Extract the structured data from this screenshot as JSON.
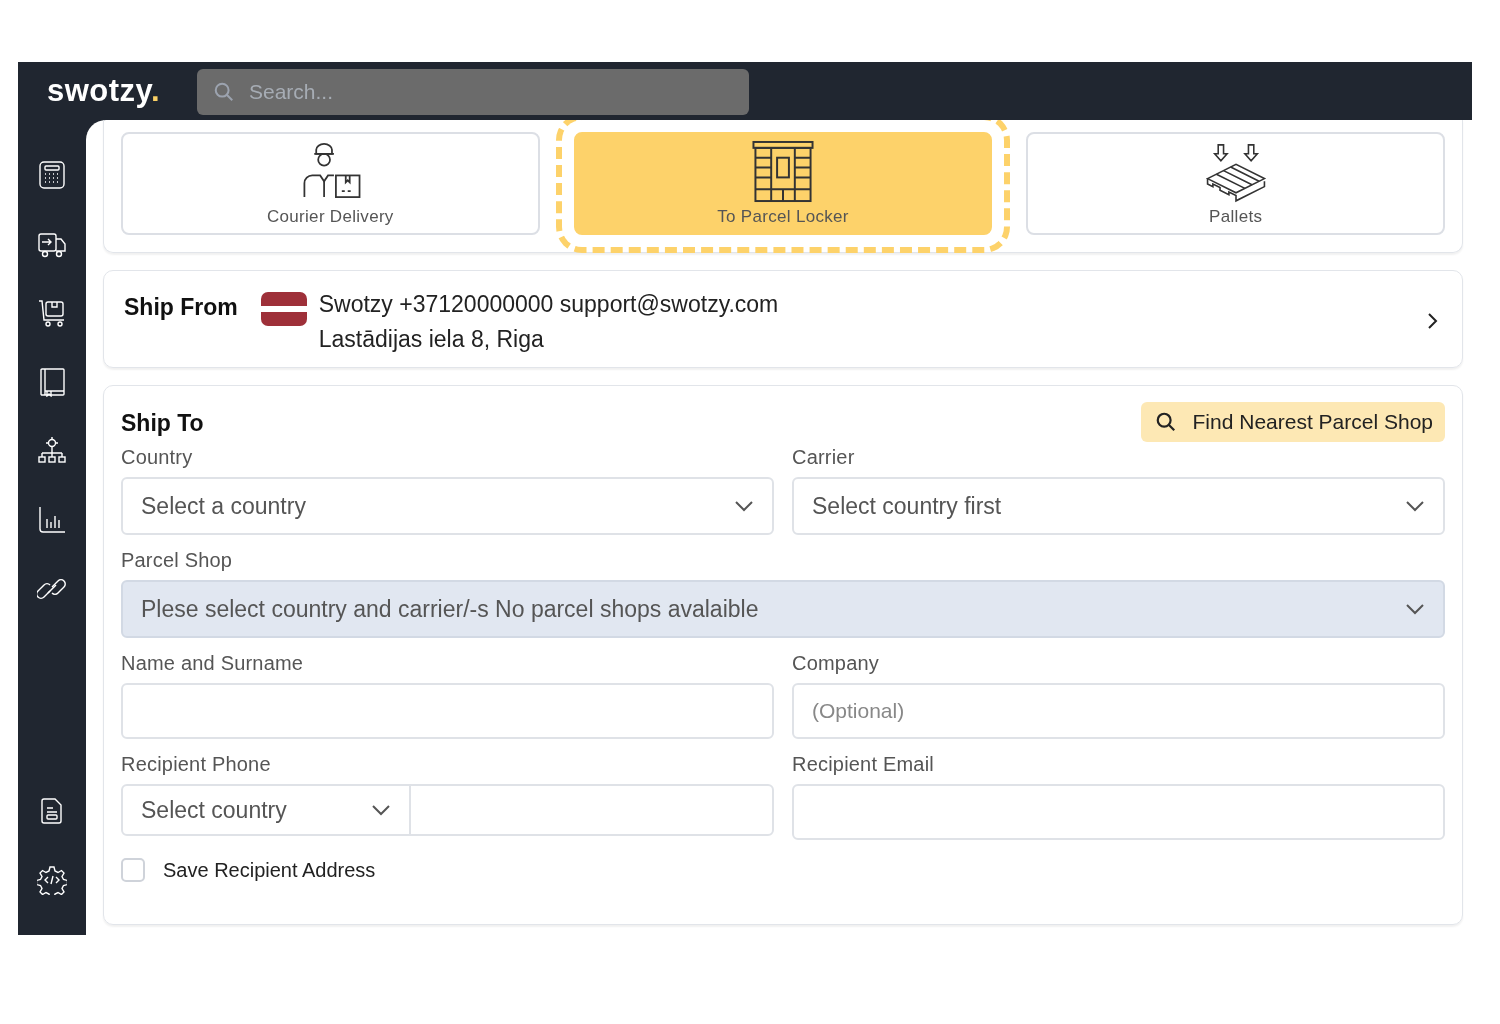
{
  "brand": {
    "name": "swotzy",
    "mark": "."
  },
  "search": {
    "placeholder": "Search..."
  },
  "sidebar": {
    "top": [
      {
        "kind": "calculator"
      },
      {
        "kind": "truck"
      },
      {
        "kind": "cart"
      },
      {
        "kind": "book"
      },
      {
        "kind": "hierarchy"
      },
      {
        "kind": "chart"
      },
      {
        "kind": "link"
      }
    ],
    "bottom": [
      {
        "kind": "document"
      },
      {
        "kind": "code-gear"
      }
    ]
  },
  "delivery_options": [
    {
      "label": "Courier Delivery",
      "kind": "courier",
      "selected": false
    },
    {
      "label": "To Parcel Locker",
      "kind": "locker",
      "selected": true
    },
    {
      "label": "Pallets",
      "kind": "pallet",
      "selected": false
    }
  ],
  "ship_from": {
    "title": "Ship From",
    "contact": "Swotzy +37120000000 support@swotzy.com",
    "address": "Lastādijas iela 8, Riga"
  },
  "ship_to": {
    "title": "Ship To",
    "find_button": "Find Nearest Parcel Shop",
    "country": {
      "label": "Country",
      "placeholder": "Select a country"
    },
    "carrier": {
      "label": "Carrier",
      "placeholder": "Select country first"
    },
    "parcel_shop": {
      "label": "Parcel Shop",
      "placeholder": "Plese select country and carrier/-s No parcel shops avalaible",
      "disabled": true
    },
    "name": {
      "label": "Name and Surname"
    },
    "company": {
      "label": "Company",
      "placeholder": "(Optional)"
    },
    "phone": {
      "label": "Recipient Phone",
      "country_placeholder": "Select country"
    },
    "email": {
      "label": "Recipient Email"
    },
    "save_address": {
      "label": "Save Recipient Address",
      "checked": false
    }
  }
}
